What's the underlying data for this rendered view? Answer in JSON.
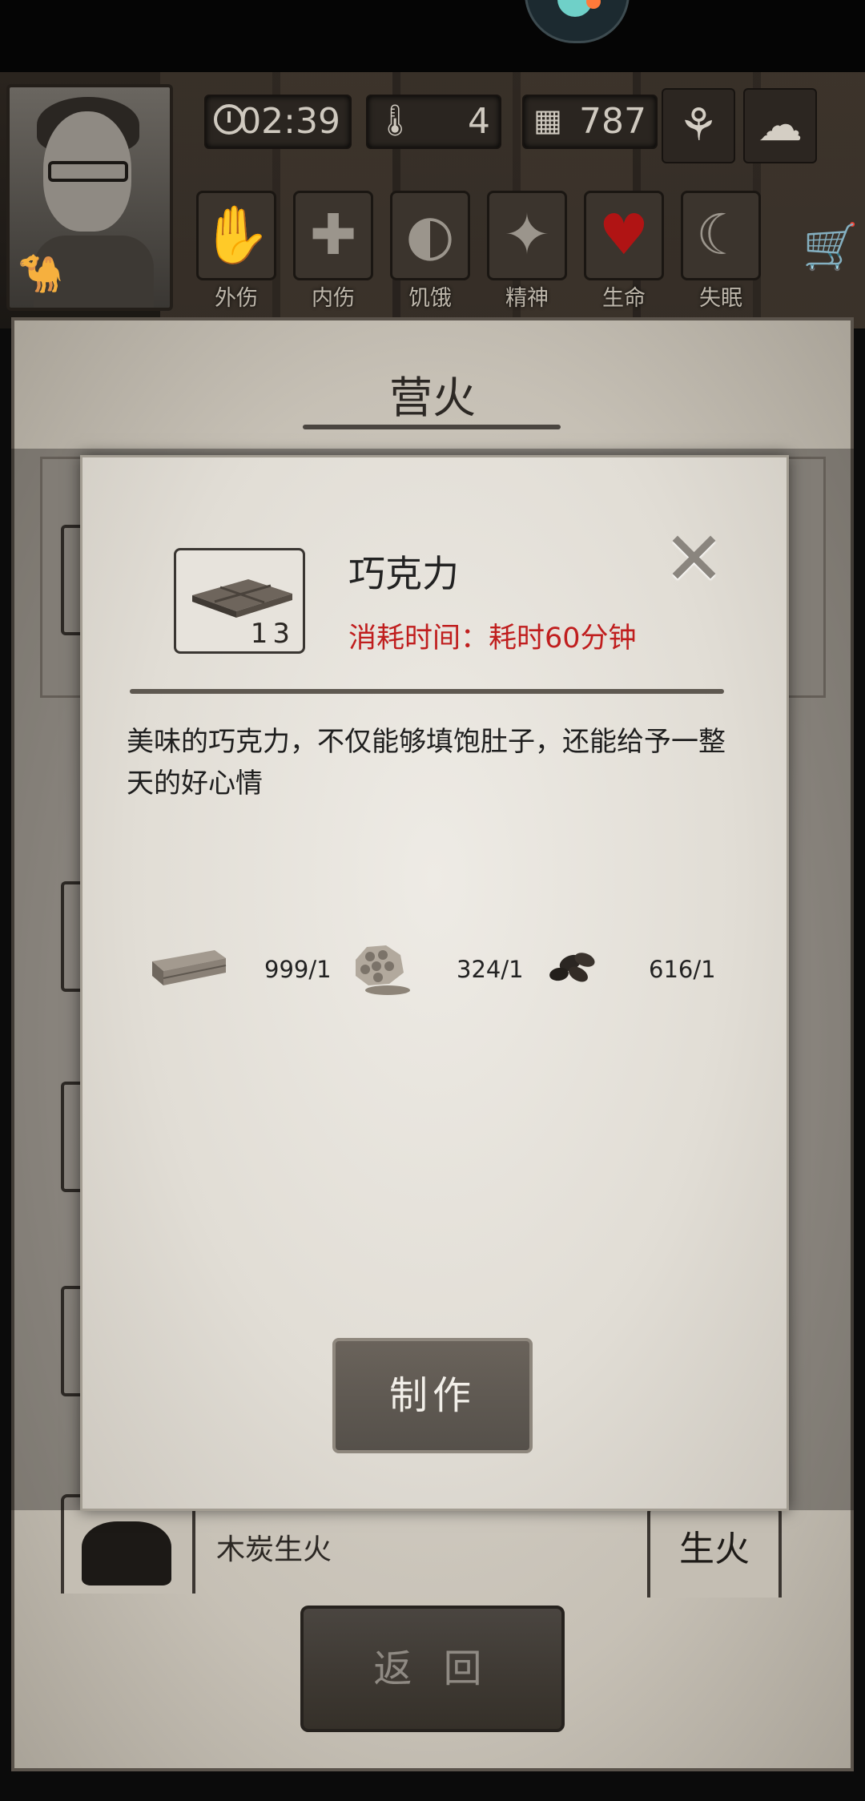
{
  "hud": {
    "time": "02:39",
    "temperature": "4",
    "day": "787",
    "status_labels": [
      "外伤",
      "内伤",
      "饥饿",
      "精神",
      "生命",
      "失眠"
    ]
  },
  "panel": {
    "title": "营火",
    "row_label": "木炭生火",
    "row_action": "生火",
    "back_label": "返 回"
  },
  "dialog": {
    "item_name": "巧克力",
    "item_count": "13",
    "time_cost": "消耗时间：耗时60分钟",
    "description": "美味的巧克力，不仅能够填饱肚子，还能给予一整天的好心情",
    "materials": [
      {
        "icon": "wood-planks-icon",
        "count": "999/1"
      },
      {
        "icon": "honeycomb-icon",
        "count": "324/1"
      },
      {
        "icon": "cocoa-beans-icon",
        "count": "616/1"
      }
    ],
    "make_label": "制作"
  },
  "colors": {
    "time_cost": "#c01e1e",
    "life_heart": "#b01414"
  }
}
